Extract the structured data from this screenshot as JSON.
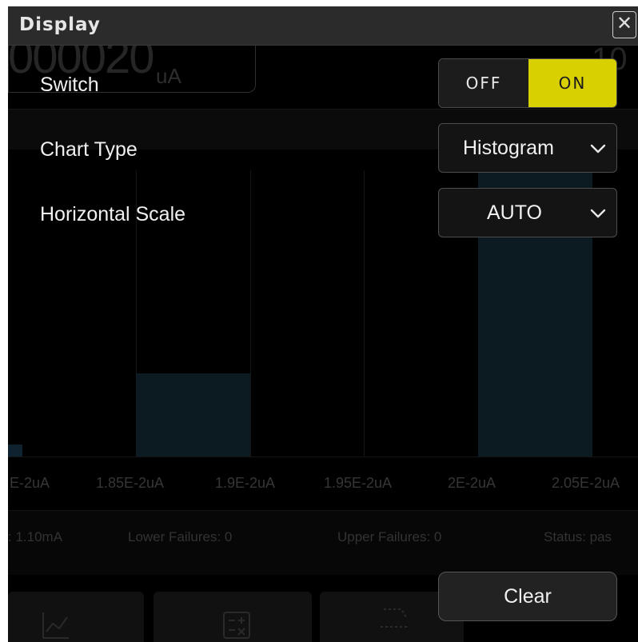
{
  "dialog": {
    "title": "Display",
    "close_glyph": "✕"
  },
  "settings": {
    "switch": {
      "label": "Switch",
      "off_label": "OFF",
      "on_label": "ON",
      "state": "ON"
    },
    "chart_type": {
      "label": "Chart Type",
      "value": "Histogram"
    },
    "horizontal_scale": {
      "label": "Horizontal Scale",
      "value": "AUTO"
    }
  },
  "actions": {
    "clear_label": "Clear"
  },
  "background": {
    "reading": "000020",
    "unit": "uA",
    "right_reading": "10",
    "x_ticks": [
      "E-2uA",
      "1.85E-2uA",
      "1.9E-2uA",
      "1.95E-2uA",
      "2E-2uA",
      "2.05E-2uA"
    ],
    "status": {
      "current": ": 1.10mA",
      "lower_failures": "Lower Failures: 0",
      "upper_failures": "Upper Failures: 0",
      "status": "Status: pas"
    }
  },
  "colors": {
    "toggle_on": "#d8d000",
    "dialog_bg": "#000000",
    "titlebar": "#2b2b2b"
  },
  "icons": [
    "chevron-down-icon",
    "close-icon",
    "chart-icon",
    "calculator-icon",
    "ruler-icon"
  ]
}
